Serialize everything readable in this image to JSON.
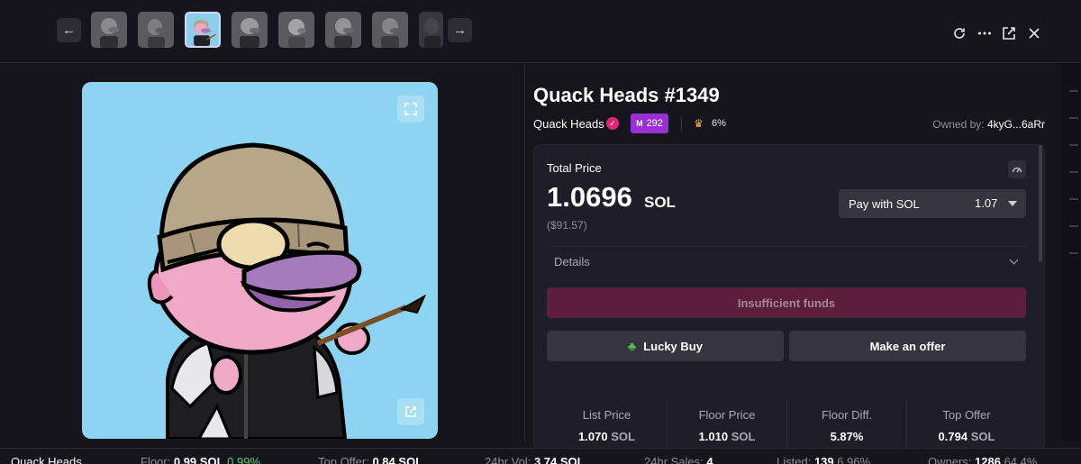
{
  "toolbar": {
    "prev_icon": "arrow-left-icon",
    "next_icon": "arrow-right-icon",
    "thumbnails": [
      "thumb-1",
      "thumb-2",
      "thumb-3",
      "thumb-4",
      "thumb-5",
      "thumb-6",
      "thumb-7",
      "thumb-8"
    ],
    "active_index": 2,
    "icons": [
      "refresh-icon",
      "more-icon",
      "external-link-icon",
      "close-icon"
    ]
  },
  "nft": {
    "title": "Quack Heads #1349",
    "collection": "Quack Heads",
    "verified_icon": "check-icon",
    "me_rank": "292",
    "top_percent": "6%",
    "owner_label": "Owned by:",
    "owner": "4kyG...6aRr",
    "background_color": "#8dd4f2"
  },
  "purchase": {
    "total_price_label": "Total Price",
    "price": "1.0696",
    "currency": "SOL",
    "usd": "($91.57)",
    "pay_with_label": "Pay with SOL",
    "pay_with_value": "1.07",
    "details_label": "Details",
    "insufficient_label": "Insufficient funds",
    "lucky_buy_label": "Lucky Buy",
    "make_offer_label": "Make an offer"
  },
  "stats": [
    {
      "label": "List Price",
      "value": "1.070",
      "unit": "SOL"
    },
    {
      "label": "Floor Price",
      "value": "1.010",
      "unit": "SOL"
    },
    {
      "label": "Floor Diff.",
      "value": "5.87%",
      "unit": ""
    },
    {
      "label": "Top Offer",
      "value": "0.794",
      "unit": "SOL"
    }
  ],
  "ticker": {
    "name": "Quack Heads",
    "floor_label": "Floor:",
    "floor_value": "0.99",
    "floor_unit": "SOL",
    "floor_change": "0.99%",
    "top_offer_label": "Top Offer:",
    "top_offer_value": "0.84",
    "top_offer_unit": "SOL",
    "vol_label": "24hr Vol:",
    "vol_value": "3.74",
    "vol_unit": "SOL",
    "sales_label": "24hr Sales:",
    "sales_value": "4",
    "listed_label": "Listed:",
    "listed_value": "139",
    "listed_pct": "6.96%",
    "owners_label": "Owners:",
    "owners_value": "1286",
    "owners_pct": "64.4%"
  },
  "colors": {
    "accent": "#9a2fd6",
    "verified": "#e42575",
    "insufficient_bg": "#5d1d3c",
    "positive": "#4fd36a"
  }
}
